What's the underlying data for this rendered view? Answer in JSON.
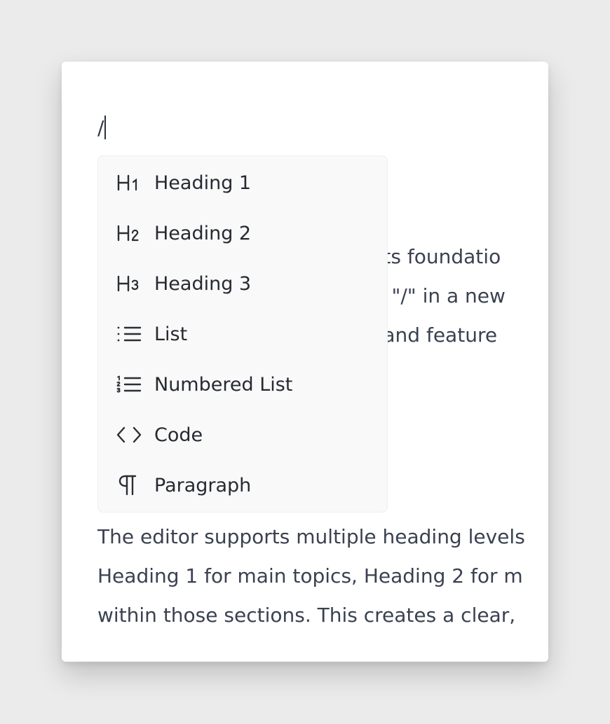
{
  "editor": {
    "input_text": "/",
    "para_top": [
      "as its foundatio",
      "ype \"/\" in a new",
      "ols and feature"
    ],
    "para_bottom": [
      "The editor supports multiple heading levels",
      "Heading 1 for main topics, Heading 2 for m",
      "within those sections. This creates a clear,"
    ]
  },
  "slash_menu": {
    "items": [
      {
        "label": "Heading 1",
        "icon": "heading-1-icon"
      },
      {
        "label": "Heading 2",
        "icon": "heading-2-icon"
      },
      {
        "label": "Heading 3",
        "icon": "heading-3-icon"
      },
      {
        "label": "List",
        "icon": "bullet-list-icon"
      },
      {
        "label": "Numbered List",
        "icon": "numbered-list-icon"
      },
      {
        "label": "Code",
        "icon": "code-icon"
      },
      {
        "label": "Paragraph",
        "icon": "paragraph-icon"
      }
    ]
  },
  "colors": {
    "background": "#ebebeb",
    "card": "#ffffff",
    "menu": "#f9f9f9",
    "text": "#3a4150"
  }
}
